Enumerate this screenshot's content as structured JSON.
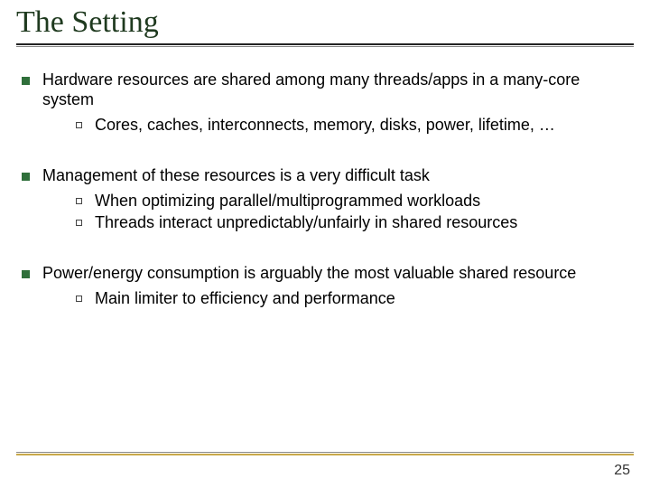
{
  "title": "The Setting",
  "bullets": {
    "b1": "Hardware resources are shared among many threads/apps in a many-core system",
    "b1_sub": {
      "s1": "Cores, caches, interconnects, memory, disks, power, lifetime, …"
    },
    "b2": "Management of these resources is a very difficult task",
    "b2_sub": {
      "s1": "When optimizing parallel/multiprogrammed workloads",
      "s2": "Threads interact unpredictably/unfairly in shared resources"
    },
    "b3": "Power/energy consumption is arguably the most valuable shared resource",
    "b3_sub": {
      "s1": "Main limiter to efficiency and performance"
    }
  },
  "page_number": "25"
}
